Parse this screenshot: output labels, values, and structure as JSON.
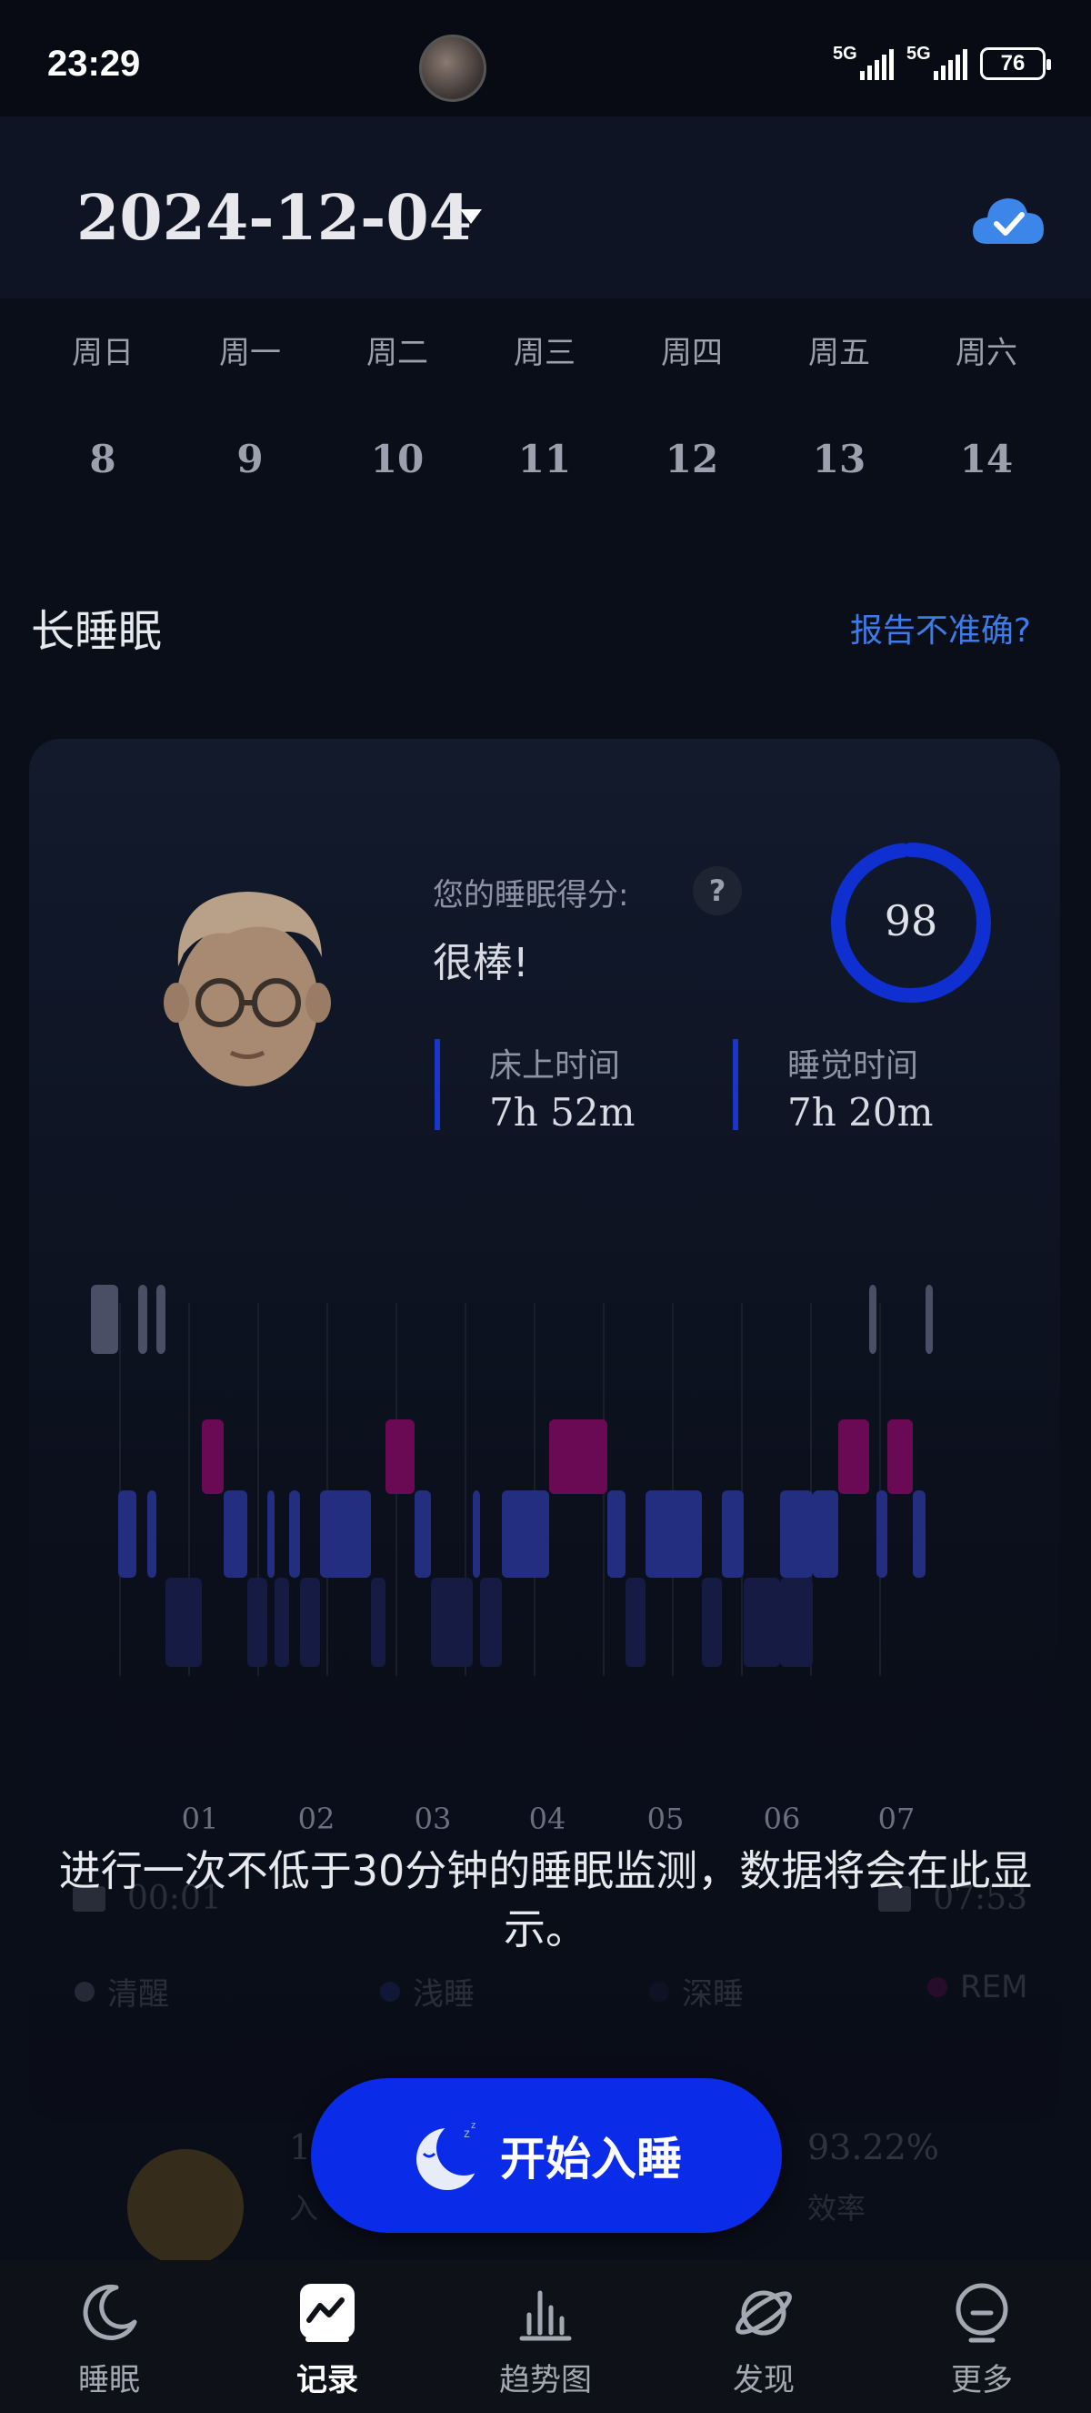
{
  "status_bar": {
    "time": "23:29",
    "network_1": "5G",
    "network_2": "5G",
    "battery": "76"
  },
  "header": {
    "date": "2024-12-04"
  },
  "week": [
    {
      "day": "周日",
      "num": "8"
    },
    {
      "day": "周一",
      "num": "9"
    },
    {
      "day": "周二",
      "num": "10"
    },
    {
      "day": "周三",
      "num": "11"
    },
    {
      "day": "周四",
      "num": "12"
    },
    {
      "day": "周五",
      "num": "13"
    },
    {
      "day": "周六",
      "num": "14"
    }
  ],
  "section": {
    "title": "长睡眠",
    "report_link": "报告不准确?"
  },
  "summary": {
    "score_label": "您的睡眠得分:",
    "help": "?",
    "score_word": "很棒!",
    "score": "98",
    "score_value": 98,
    "bed_time_label": "床上时间",
    "bed_time_value": "7h 52m",
    "sleep_time_label": "睡觉时间",
    "sleep_time_value": "7h 20m"
  },
  "chart_data": {
    "type": "bar",
    "title": "",
    "stages": [
      "清醒",
      "浅睡",
      "深睡",
      "REM"
    ],
    "x_ticks": [
      "01",
      "02",
      "03",
      "04",
      "05",
      "06",
      "07"
    ],
    "start_time": "00:01",
    "end_time": "07:53"
  },
  "times": {
    "start": "00:01",
    "end": "07:53"
  },
  "legend": [
    {
      "label": "清醒",
      "color": "#8a8fa6"
    },
    {
      "label": "浅睡",
      "color": "#2b3a9c"
    },
    {
      "label": "深睡",
      "color": "#1a2050"
    },
    {
      "label": "REM",
      "color": "#8a0d6e"
    }
  ],
  "empty_message": "进行一次不低于30分钟的睡眠监测，数据将会在此显示。",
  "stats": {
    "start": "1",
    "start_label": "入",
    "efficiency": "93.22%",
    "efficiency_label": "效率"
  },
  "cta": {
    "label": "开始入睡"
  },
  "nav": [
    {
      "label": "睡眠",
      "active": false
    },
    {
      "label": "记录",
      "active": true
    },
    {
      "label": "趋势图",
      "active": false
    },
    {
      "label": "发现",
      "active": false
    },
    {
      "label": "更多",
      "active": false
    }
  ],
  "colors": {
    "accent": "#0a2be8",
    "link": "#3d7ce8",
    "ring": "#0f2fd0",
    "rem": "#8a0d6e",
    "light": "#2b3a9c"
  }
}
